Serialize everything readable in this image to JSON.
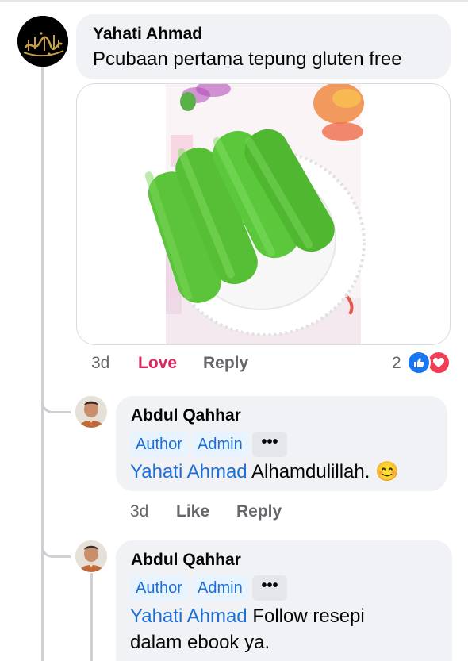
{
  "comments": [
    {
      "author": "Yahati Ahmad",
      "text": "Pcubaan pertama tepung gluten free",
      "time": "3d",
      "love_label": "Love",
      "reply_label": "Reply",
      "reaction_count": "2"
    }
  ],
  "replies": [
    {
      "author": "Abdul Qahhar",
      "badges": [
        "Author",
        "Admin"
      ],
      "more_label": "•••",
      "mention": "Yahati Ahmad",
      "text": "Alhamdulillah.",
      "emoji": "😊",
      "time": "3d",
      "like_label": "Like",
      "reply_label": "Reply"
    },
    {
      "author": "Abdul Qahhar",
      "badges": [
        "Author",
        "Admin"
      ],
      "more_label": "•••",
      "mention": "Yahati Ahmad",
      "text_line1": "Follow resepi",
      "text_line2": "dalam ebook ya."
    }
  ],
  "colors": {
    "mention": "#1d6fd6",
    "love": "#e0245e",
    "bubble": "#f0f2f5",
    "leaf_green": "#5cc43a"
  },
  "icons": {
    "like_reaction": "like-thumb-icon",
    "love_reaction": "heart-icon"
  }
}
